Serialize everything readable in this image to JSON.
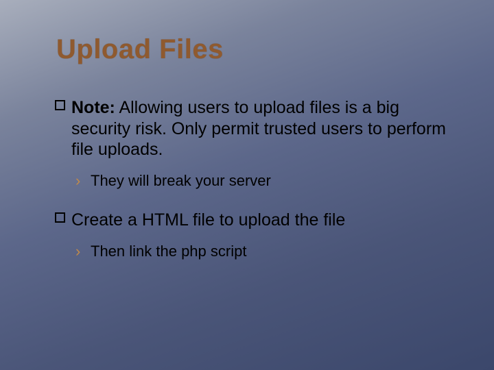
{
  "title": "Upload Files",
  "bullets": [
    {
      "lead": "Note:",
      "rest": " Allowing users to upload files is a big security risk. Only permit trusted users to perform file uploads.",
      "sub": "They will break your server"
    },
    {
      "lead": "",
      "rest": "Create a HTML file to upload the file",
      "sub": "Then link the php script"
    }
  ],
  "glyphs": {
    "angle": "›"
  }
}
